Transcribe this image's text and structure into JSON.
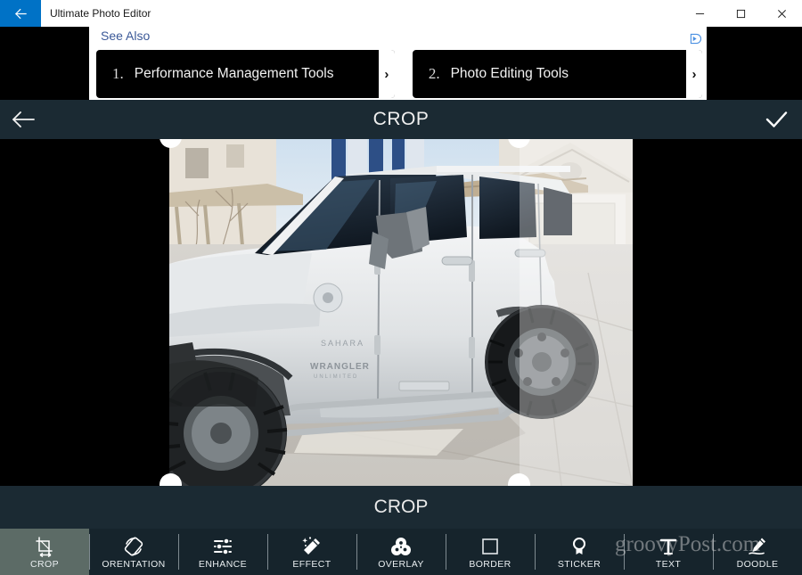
{
  "window": {
    "title": "Ultimate Photo Editor",
    "back_icon": "arrow-left-icon",
    "minimize_label": "–",
    "maximize_label": "☐",
    "close_label": "✕"
  },
  "ad": {
    "see_also": "See Also",
    "adchoices_icon": "adchoices-icon",
    "cards": [
      {
        "number": "1.",
        "text": "Performance Management Tools",
        "arrow": "›"
      },
      {
        "number": "2.",
        "text": "Photo Editing Tools",
        "arrow": "›"
      }
    ]
  },
  "header": {
    "back_icon": "arrow-left-icon",
    "title": "CROP",
    "confirm_icon": "check-icon"
  },
  "canvas": {
    "image_description": "Silver Jeep Wrangler Unlimited Sahara parked in a concrete driveway in front of a house",
    "crop_label": "CROP"
  },
  "toolbar": {
    "selected": "CROP",
    "items": [
      {
        "label": "CROP",
        "icon": "crop-icon",
        "selected": true
      },
      {
        "label": "ORENTATION",
        "icon": "rotate-icon",
        "selected": false
      },
      {
        "label": "ENHANCE",
        "icon": "sliders-icon",
        "selected": false
      },
      {
        "label": "EFFECT",
        "icon": "magic-wand-icon",
        "selected": false
      },
      {
        "label": "OVERLAY",
        "icon": "overlay-icon",
        "selected": false
      },
      {
        "label": "BORDER",
        "icon": "square-icon",
        "selected": false
      },
      {
        "label": "STICKER",
        "icon": "sticker-icon",
        "selected": false
      },
      {
        "label": "TEXT",
        "icon": "text-icon",
        "selected": false
      },
      {
        "label": "DOODLE",
        "icon": "pencil-icon",
        "selected": false
      }
    ]
  },
  "watermark": {
    "text": "groovyPost.com"
  },
  "colors": {
    "titlebar_bg": "#ffffff",
    "back_accent": "#0072c6",
    "header_bg": "#1b2a33",
    "toolbar_bg": "#16242c",
    "selected_tool_bg": "#5c6b66",
    "link_blue": "#3b5998",
    "canvas_bg": "#000000"
  }
}
